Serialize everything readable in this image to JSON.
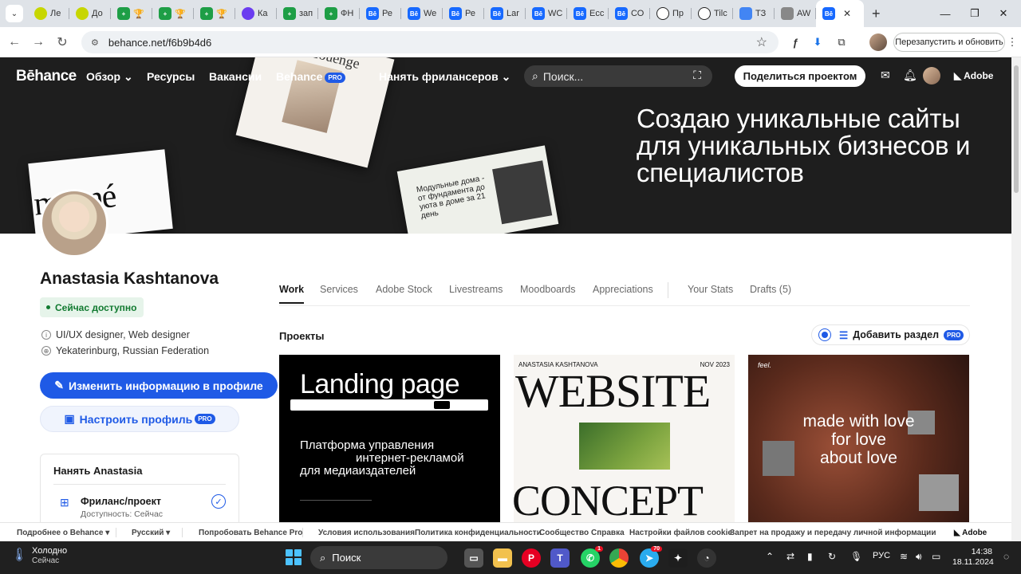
{
  "browser": {
    "tabs": [
      {
        "label": "Ле",
        "icon": "lime"
      },
      {
        "label": "До",
        "icon": "lime"
      },
      {
        "label": "🏆",
        "icon": "green"
      },
      {
        "label": "🏆",
        "icon": "green"
      },
      {
        "label": "🏆",
        "icon": "green"
      },
      {
        "label": "Ка",
        "icon": "purple"
      },
      {
        "label": "зап",
        "icon": "green"
      },
      {
        "label": "ФН",
        "icon": "green"
      },
      {
        "label": "Ре",
        "icon": "be"
      },
      {
        "label": "We",
        "icon": "be"
      },
      {
        "label": "Ре",
        "icon": "be"
      },
      {
        "label": "Lar",
        "icon": "be"
      },
      {
        "label": "WC",
        "icon": "be"
      },
      {
        "label": "Ecc",
        "icon": "be"
      },
      {
        "label": "СО",
        "icon": "be"
      },
      {
        "label": "Пр",
        "icon": "dark"
      },
      {
        "label": "Tilc",
        "icon": "dark"
      },
      {
        "label": "ТЗ",
        "icon": "docs"
      },
      {
        "label": "AW",
        "icon": "gray"
      }
    ],
    "active_tab_icon": "Bē",
    "url": "behance.net/f6b9b4d6",
    "restart_label": "Перезапустить и обновить"
  },
  "header": {
    "logo": "Bēhance",
    "nav": {
      "explore": "Обзор",
      "resources": "Ресурсы",
      "jobs": "Вакансии",
      "behance_pro": "Behance",
      "pro_badge": "PRO",
      "hire": "Нанять фрилансеров"
    },
    "search_placeholder": "Поиск...",
    "share_button": "Поделиться проектом",
    "adobe": "Adobe"
  },
  "banner": {
    "tagline": "Создаю уникальные сайты для уникальных бизнесов и специалистов",
    "mock1_title": "Louenge",
    "mock2_title": "manné",
    "mock3_text": "Модульные дома - от фундамента до уюта в доме за 21 день"
  },
  "profile": {
    "name": "Anastasia Kashtanova",
    "status": "Сейчас доступно",
    "occupation": "UI/UX designer, Web designer",
    "location": "Yekaterinburg, Russian Federation",
    "edit_button": "Изменить информацию в профиле",
    "customize_button": "Настроить профиль",
    "pro_badge": "PRO",
    "hire_title": "Нанять Anastasia",
    "hire_item": "Фриланс/проект",
    "hire_availability": "Доступность: Сейчас"
  },
  "tabs": {
    "work": "Work",
    "services": "Services",
    "adobe_stock": "Adobe Stock",
    "livestreams": "Livestreams",
    "moodboards": "Moodboards",
    "appreciations": "Appreciations",
    "your_stats": "Your Stats",
    "drafts": "Drafts (5)"
  },
  "projects": {
    "heading": "Проекты",
    "add_section": "Добавить раздел",
    "pro_badge": "PRO",
    "card1": {
      "title": "Landing page",
      "line1": "Платформа управления",
      "line2": "интернет-рекламой",
      "line3": "для медиаиздателей"
    },
    "card2": {
      "author": "ANASTASIA KASHTANOVA",
      "date": "NOV 2023",
      "word1": "WEBSITE",
      "word2": "CONCEPT"
    },
    "card3": {
      "logo": "feel.",
      "line1": "made with love",
      "line2": "for love",
      "line3": "about love"
    }
  },
  "footer": {
    "more": "Подробнее о Behance ▾",
    "lang": "Русский ▾",
    "try_pro": "Попробовать Behance Pro",
    "terms": "Условия использования",
    "privacy": "Политика конфиденциальности",
    "community": "Сообщество",
    "help": "Справка",
    "cookies": "Настройки файлов cookie",
    "no_sell": "Запрет на продажу и передачу личной информации",
    "adobe": "Adobe"
  },
  "taskbar": {
    "weather_title": "Холодно",
    "weather_sub": "Сейчас",
    "search": "Поиск",
    "lang": "РУС",
    "time": "14:38",
    "date": "18.11.2024",
    "telegram_badge": "70",
    "whatsapp_badge": "1"
  }
}
